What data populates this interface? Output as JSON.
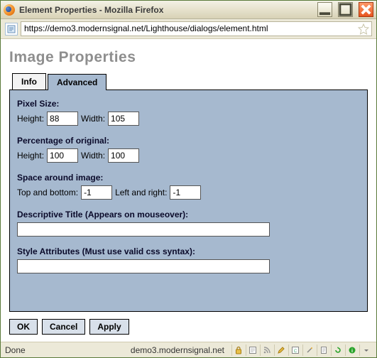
{
  "window": {
    "title": "Element Properties - Mozilla Firefox"
  },
  "urlbar": {
    "url": "https://demo3.modernsignal.net/Lighthouse/dialogs/element.html"
  },
  "page": {
    "heading": "Image Properties"
  },
  "tabs": {
    "info": "Info",
    "advanced": "Advanced"
  },
  "form": {
    "pixel_size_label": "Pixel Size:",
    "pixel_height_label": "Height:",
    "pixel_height_value": "88",
    "pixel_width_label": "Width:",
    "pixel_width_value": "105",
    "percent_label": "Percentage of original:",
    "percent_height_label": "Height:",
    "percent_height_value": "100",
    "percent_width_label": "Width:",
    "percent_width_value": "100",
    "space_label": "Space around image:",
    "space_tb_label": "Top and bottom:",
    "space_tb_value": "-1",
    "space_lr_label": "Left and right:",
    "space_lr_value": "-1",
    "desc_title_label": "Descriptive Title (Appears on mouseover):",
    "desc_title_value": "",
    "style_attr_label": "Style Attributes (Must use valid css syntax):",
    "style_attr_value": ""
  },
  "buttons": {
    "ok": "OK",
    "cancel": "Cancel",
    "apply": "Apply"
  },
  "status": {
    "left": "Done",
    "domain": "demo3.modernsignal.net"
  }
}
